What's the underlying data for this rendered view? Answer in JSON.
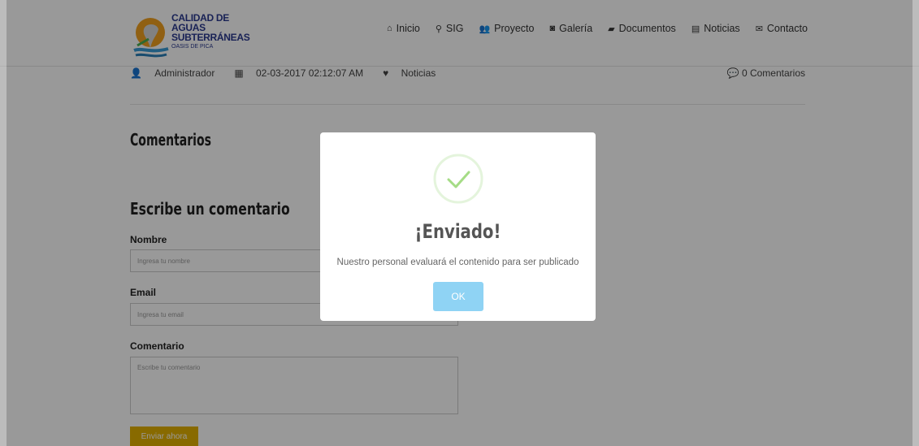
{
  "logo": {
    "line1": "CALIDAD DE AGUAS",
    "line2": "SUBTERRÁNEAS",
    "line3": "OASIS DE PICA"
  },
  "nav": {
    "items": [
      {
        "label": "Inicio",
        "icon": "home-icon"
      },
      {
        "label": "SIG",
        "icon": "map-marker-icon"
      },
      {
        "label": "Proyecto",
        "icon": "users-icon"
      },
      {
        "label": "Galería",
        "icon": "camera-icon"
      },
      {
        "label": "Documentos",
        "icon": "folder-icon"
      },
      {
        "label": "Noticias",
        "icon": "document-icon"
      },
      {
        "label": "Contacto",
        "icon": "envelope-icon"
      }
    ]
  },
  "post_meta": {
    "author": "Administrador",
    "date": "02-03-2017 02:12:07 AM",
    "category": "Noticias",
    "comments": "0 Comentarios"
  },
  "comments_section": {
    "title": "Comentarios"
  },
  "form": {
    "title": "Escribe un comentario",
    "name_label": "Nombre",
    "name_placeholder": "Ingresa tu nombre",
    "email_label": "Email",
    "email_placeholder": "Ingresa tu email",
    "comment_label": "Comentario",
    "comment_placeholder": "Escribe tu comentario",
    "submit_label": "Enviar ahora"
  },
  "modal": {
    "title": "¡Enviado!",
    "message": "Nuestro personal evaluará el contenido para ser publicado",
    "ok_label": "OK"
  },
  "colors": {
    "accent": "#e3b100",
    "success": "#a5dc86",
    "ok_button": "#8fd3f4"
  }
}
